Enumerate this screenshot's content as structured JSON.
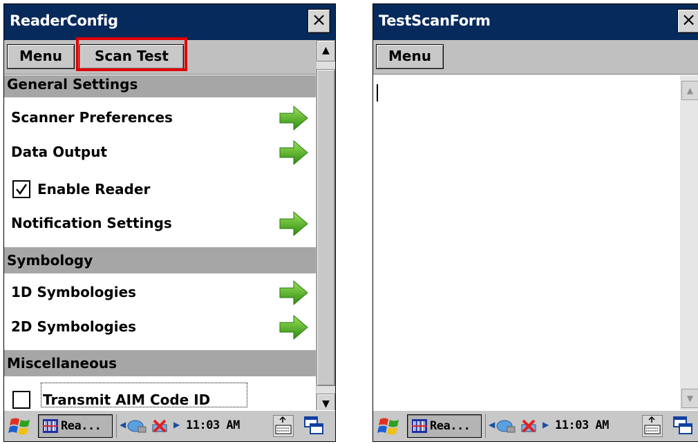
{
  "left_window": {
    "title": "ReaderConfig",
    "close_label": "×",
    "menu": {
      "menu_label": "Menu",
      "scan_test_label": "Scan Test"
    },
    "sections": [
      {
        "header": "General Settings"
      },
      {
        "header": "Symbology"
      },
      {
        "header": "Miscellaneous"
      }
    ],
    "items": {
      "scanner_preferences": "Scanner Preferences",
      "data_output": "Data Output",
      "enable_reader": "Enable Reader",
      "notification_settings": "Notification Settings",
      "symbologies_1d": "1D Symbologies",
      "symbologies_2d": "2D Symbologies",
      "transmit_aim": "Transmit AIM Code ID"
    },
    "checkboxes": {
      "enable_reader_checked": true,
      "transmit_aim_checked": false
    },
    "icons": {
      "nav_arrow": "green-right-arrow-icon"
    },
    "colors": {
      "title_bar": "#072a5c",
      "highlight": "#e00000",
      "arrow_green": "#4caf1e"
    }
  },
  "right_window": {
    "title": "TestScanForm",
    "close_label": "×",
    "menu": {
      "menu_label": "Menu"
    },
    "text_value": ""
  },
  "taskbar": {
    "task_label": "Rea...",
    "clock": "11:03 AM",
    "icons": [
      "windows-start-icon",
      "reader-app-icon",
      "network-icon",
      "battery-alert-icon",
      "keyboard-icon",
      "sip-icon"
    ]
  }
}
